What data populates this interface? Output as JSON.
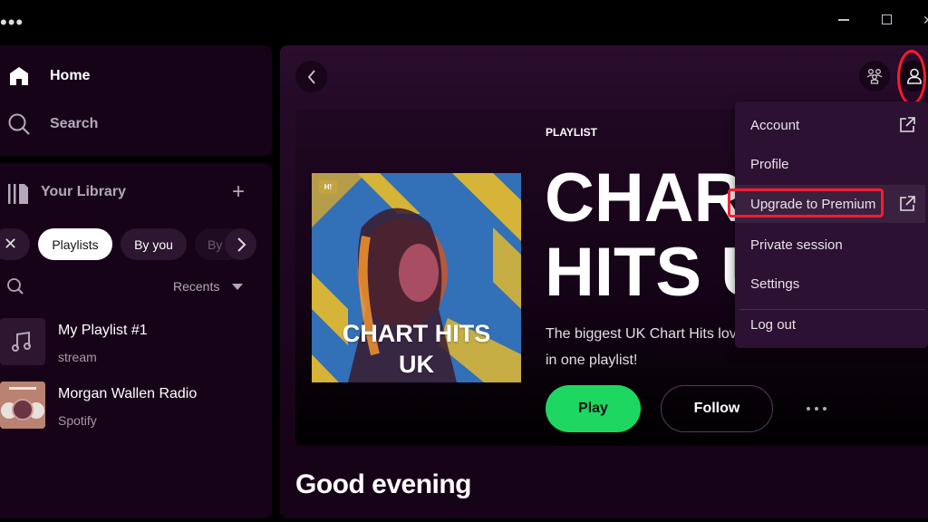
{
  "window": {
    "menu_dots": "•••",
    "close_glyph": "✕"
  },
  "nav": {
    "home_label": "Home",
    "search_label": "Search"
  },
  "library": {
    "title": "Your Library",
    "add_glyph": "+",
    "filters": {
      "clear_glyph": "✕",
      "chips": [
        "Playlists",
        "By you",
        "By"
      ],
      "active": "Playlists"
    },
    "sort_label": "Recents",
    "items": [
      {
        "title": "My Playlist #1",
        "subtitle": "stream",
        "thumb": "music-note"
      },
      {
        "title": "Morgan Wallen Radio",
        "subtitle": "Spotify",
        "thumb": "artist-collage"
      }
    ]
  },
  "hero": {
    "type_label": "PLAYLIST",
    "title_line1": "CHART",
    "title_line2": "HITS UK",
    "description": "The biggest UK Chart Hits love in one playlist!",
    "cover": {
      "badge": "H!",
      "title_line1": "CHART HITS",
      "title_line2": "UK",
      "colors": {
        "background": "#3270b8",
        "stripe": "#d6b437"
      }
    },
    "play_label": "Play",
    "follow_label": "Follow"
  },
  "greeting": "Good evening",
  "account_menu": {
    "items": [
      {
        "label": "Account",
        "external": true
      },
      {
        "label": "Profile",
        "external": false
      },
      {
        "label": "Upgrade to Premium",
        "external": true,
        "highlighted": true
      },
      {
        "label": "Private session",
        "external": false
      },
      {
        "label": "Settings",
        "external": false
      },
      {
        "label": "Log out",
        "external": false
      }
    ]
  },
  "colors": {
    "accent_green": "#1ed760",
    "panel_bg": "#170318",
    "menu_bg": "#2c1132",
    "annotation_red": "#ff1a2e"
  }
}
